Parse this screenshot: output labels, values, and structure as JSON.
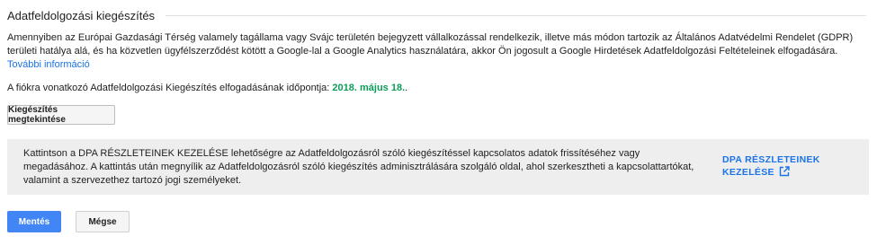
{
  "section": {
    "title": "Adatfeldolgozási kiegészítés",
    "description": "Amennyiben az Európai Gazdasági Térség valamely tagállama vagy Svájc területén bejegyzett vállalkozással rendelkezik, illetve más módon tartozik az Általános Adatvédelmi Rendelet (GDPR) területi hatálya alá, és ha közvetlen ügyfélszerződést kötött a Google-lal a Google Analytics használatára, akkor Ön jogosult a Google Hirdetések Adatfeldolgozási Feltételeinek elfogadására.",
    "more_info_link": "További információ",
    "acceptance_label": "A fiókra vonatkozó Adatfeldolgozási Kiegészítés elfogadásának időpontja:",
    "acceptance_date": "2018. május 18.",
    "acceptance_suffix": ".",
    "view_button": "Kiegészítés megtekintése"
  },
  "notice": {
    "text": "Kattintson a DPA RÉSZLETEINEK KEZELÉSE lehetőségre az Adatfeldolgozásról szóló kiegészítéssel kapcsolatos adatok frissítéséhez vagy megadásához. A kattintás után megnyílik az Adatfeldolgozásról szóló kiegészítés adminisztrálására szolgáló oldal, ahol szerkesztheti a kapcsolattartókat, valamint a szervezethez tartozó jogi személyeket.",
    "link_label": "DPA RÉSZLETEINEK KEZELÉSE",
    "link_icon": "open-in-new-icon",
    "link_color": "#1a73e8"
  },
  "actions": {
    "save": "Mentés",
    "cancel": "Mégse",
    "save_color": "#4285f4"
  },
  "colors": {
    "date_green": "#0d9d58",
    "notice_bg": "#eeeeee"
  }
}
